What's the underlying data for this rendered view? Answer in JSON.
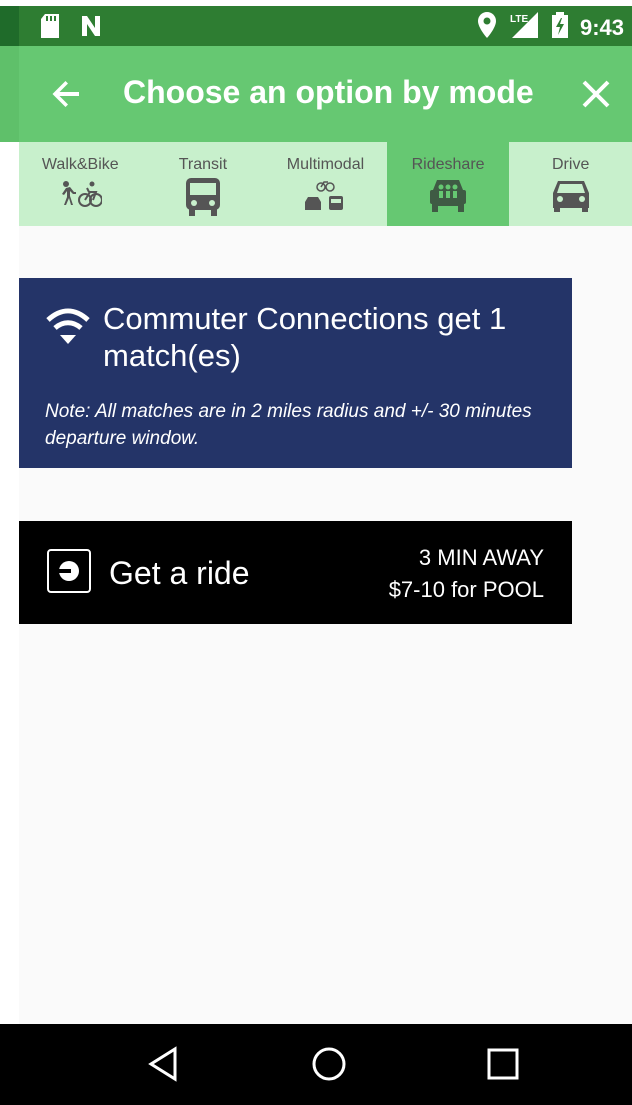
{
  "status_bar": {
    "time": "9:43",
    "network": "LTE",
    "icons": [
      "sd-card-icon",
      "notification-n-icon",
      "location-icon",
      "signal-icon",
      "battery-charging-icon"
    ]
  },
  "app_bar": {
    "title": "Choose an option by mode",
    "back_icon": "arrow-back-icon",
    "close_icon": "close-icon"
  },
  "mode_tabs": [
    {
      "label": "Walk&Bike",
      "icon": "walk-bike-icon",
      "active": false
    },
    {
      "label": "Transit",
      "icon": "bus-icon",
      "active": false
    },
    {
      "label": "Multimodal",
      "icon": "multimodal-icon",
      "active": false
    },
    {
      "label": "Rideshare",
      "icon": "rideshare-icon",
      "active": true
    },
    {
      "label": "Drive",
      "icon": "car-icon",
      "active": false
    }
  ],
  "commuter_card": {
    "title": "Commuter Connections get 1 match(es)",
    "note": "Note: All matches are in 2 miles radius and +/- 30 minutes departure window.",
    "icon": "wifi-icon"
  },
  "ride_card": {
    "label": "Get a ride",
    "eta": "3 MIN AWAY",
    "price": "$7-10 for POOL",
    "icon": "uber-logo-icon"
  },
  "nav_bar": {
    "icons": [
      "nav-back-icon",
      "nav-home-icon",
      "nav-recents-icon"
    ]
  },
  "colors": {
    "status_bar": "#2e7d32",
    "app_bar": "#66c872",
    "tabs_bg": "#c8f0cc",
    "tab_active": "#66c872",
    "commuter_card": "#243468",
    "ride_card": "#000000"
  }
}
